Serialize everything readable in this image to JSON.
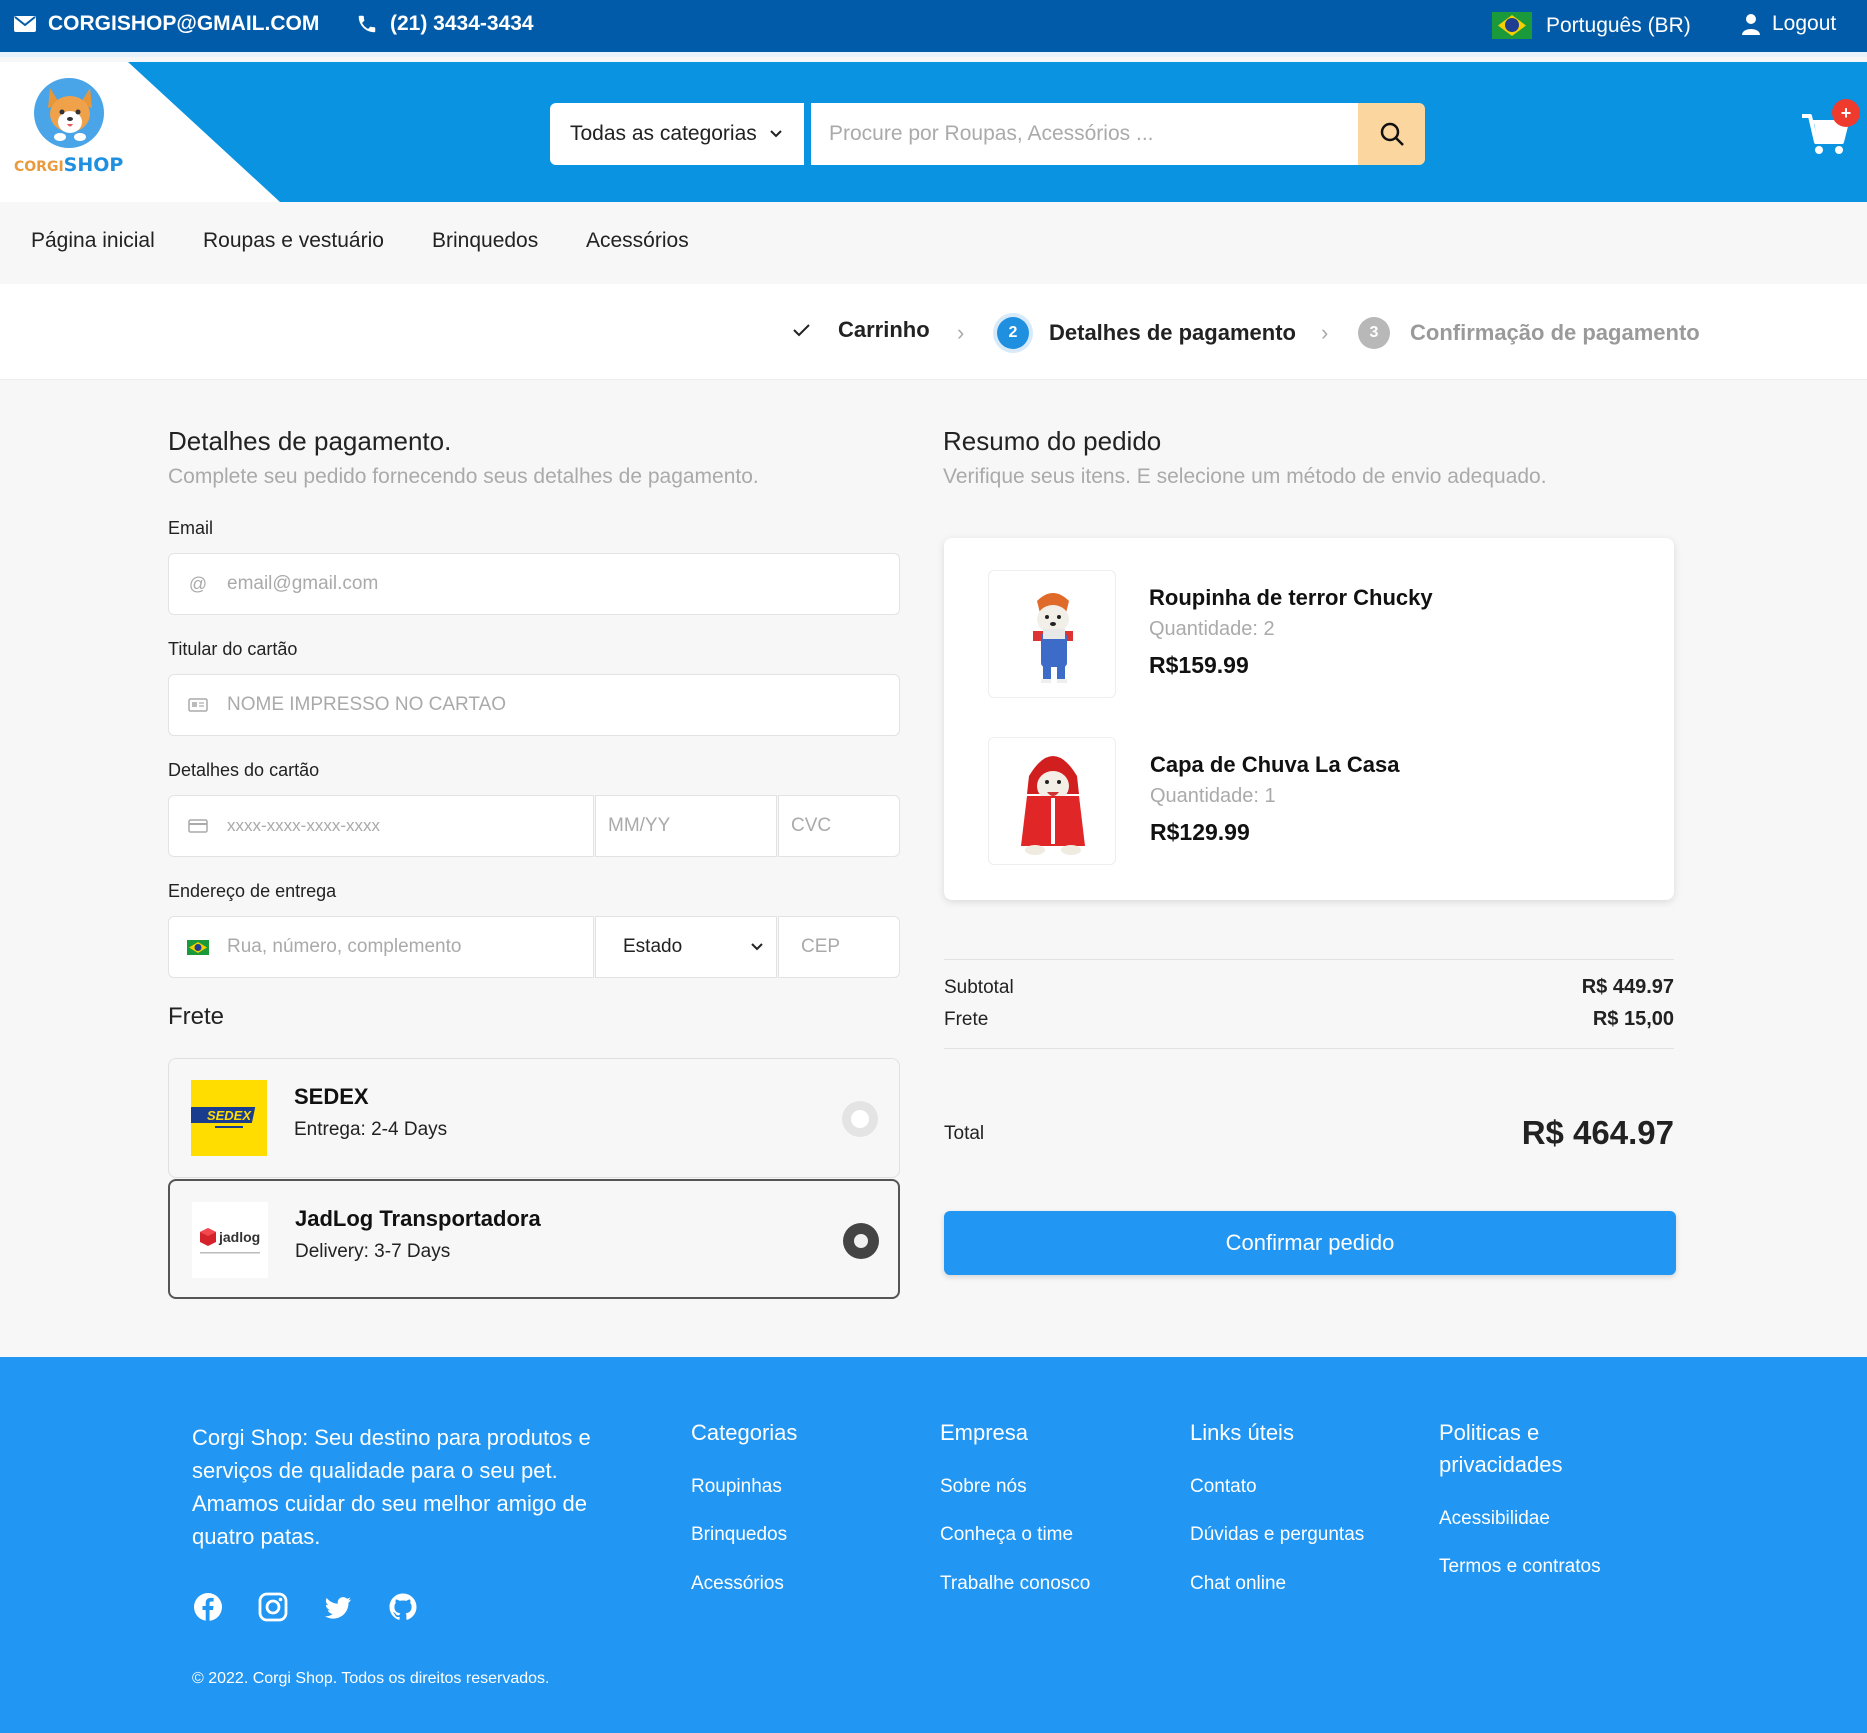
{
  "topbar": {
    "email": "CORGISHOP@GMAIL.COM",
    "phone": "(21) 3434-3434",
    "language": "Português (BR)",
    "logout": "Logout"
  },
  "header": {
    "logo_part1": "CORGI",
    "logo_part2": "SHOP",
    "category_select": "Todas as categorias",
    "search_placeholder": "Procure por Roupas, Acessórios ...",
    "cart_badge": "+"
  },
  "nav": [
    "Página inicial",
    "Roupas e vestuário",
    "Brinquedos",
    "Acessórios"
  ],
  "steps": {
    "step1_label": "Carrinho",
    "step2_number": "2",
    "step2_label": "Detalhes de pagamento",
    "step3_number": "3",
    "step3_label": "Confirmação de pagamento"
  },
  "payment": {
    "title": "Detalhes de pagamento.",
    "subtitle": "Complete seu pedido fornecendo seus detalhes de pagamento.",
    "email_label": "Email",
    "email_placeholder": "email@gmail.com",
    "holder_label": "Titular do cartão",
    "holder_placeholder": "NOME IMPRESSO NO CARTAO",
    "card_label": "Detalhes do cartão",
    "card_placeholder": "xxxx-xxxx-xxxx-xxxx",
    "expiry_placeholder": "MM/YY",
    "cvc_placeholder": "CVC",
    "address_label": "Endereço de entrega",
    "address_placeholder": "Rua, número, complemento",
    "state_select": "Estado",
    "zip_placeholder": "CEP",
    "shipping_title": "Frete",
    "shipping": [
      {
        "name": "SEDEX",
        "eta": "Entrega: 2-4 Days",
        "logo_text": "SEDEX",
        "selected": false
      },
      {
        "name": "JadLog Transportadora",
        "eta": "Delivery: 3-7 Days",
        "logo_text": "jadlog",
        "selected": true
      }
    ]
  },
  "summary": {
    "title": "Resumo do pedido",
    "subtitle": "Verifique seus itens. E selecione um método de envio adequado.",
    "items": [
      {
        "name": "Roupinha de terror Chucky",
        "qty": "Quantidade: 2",
        "price": "R$159.99"
      },
      {
        "name": "Capa de Chuva La Casa",
        "qty": "Quantidade: 1",
        "price": "R$129.99"
      }
    ],
    "subtotal_label": "Subtotal",
    "subtotal_value": "R$ 449.97",
    "shipping_label": "Frete",
    "shipping_value": "R$ 15,00",
    "total_label": "Total",
    "total_value": "R$ 464.97",
    "confirm_button": "Confirmar pedido"
  },
  "footer": {
    "about": "Corgi Shop: Seu destino para produtos e serviços de qualidade para o seu pet. Amamos cuidar do seu melhor amigo de quatro patas.",
    "columns": [
      {
        "title": "Categorias",
        "links": [
          "Roupinhas",
          "Brinquedos",
          "Acessórios"
        ]
      },
      {
        "title": "Empresa",
        "links": [
          "Sobre nós",
          "Conheça o time",
          "Trabalhe conosco"
        ]
      },
      {
        "title": "Links úteis",
        "links": [
          "Contato",
          "Dúvidas e perguntas",
          "Chat online"
        ]
      },
      {
        "title": "Politicas e privacidades",
        "links": [
          "Acessibilidae",
          "Termos e contratos"
        ]
      }
    ],
    "social_icons": [
      "facebook-icon",
      "instagram-icon",
      "twitter-icon",
      "github-icon"
    ],
    "copyright": "© 2022. Corgi Shop. Todos os direitos reservados."
  },
  "colors": {
    "topbar": "#015ba8",
    "header": "#0a93e0",
    "accent": "#2196f3",
    "search_button": "#fbd79f",
    "sedex_yellow": "#ffdd00",
    "badge": "#ef3b2d"
  }
}
